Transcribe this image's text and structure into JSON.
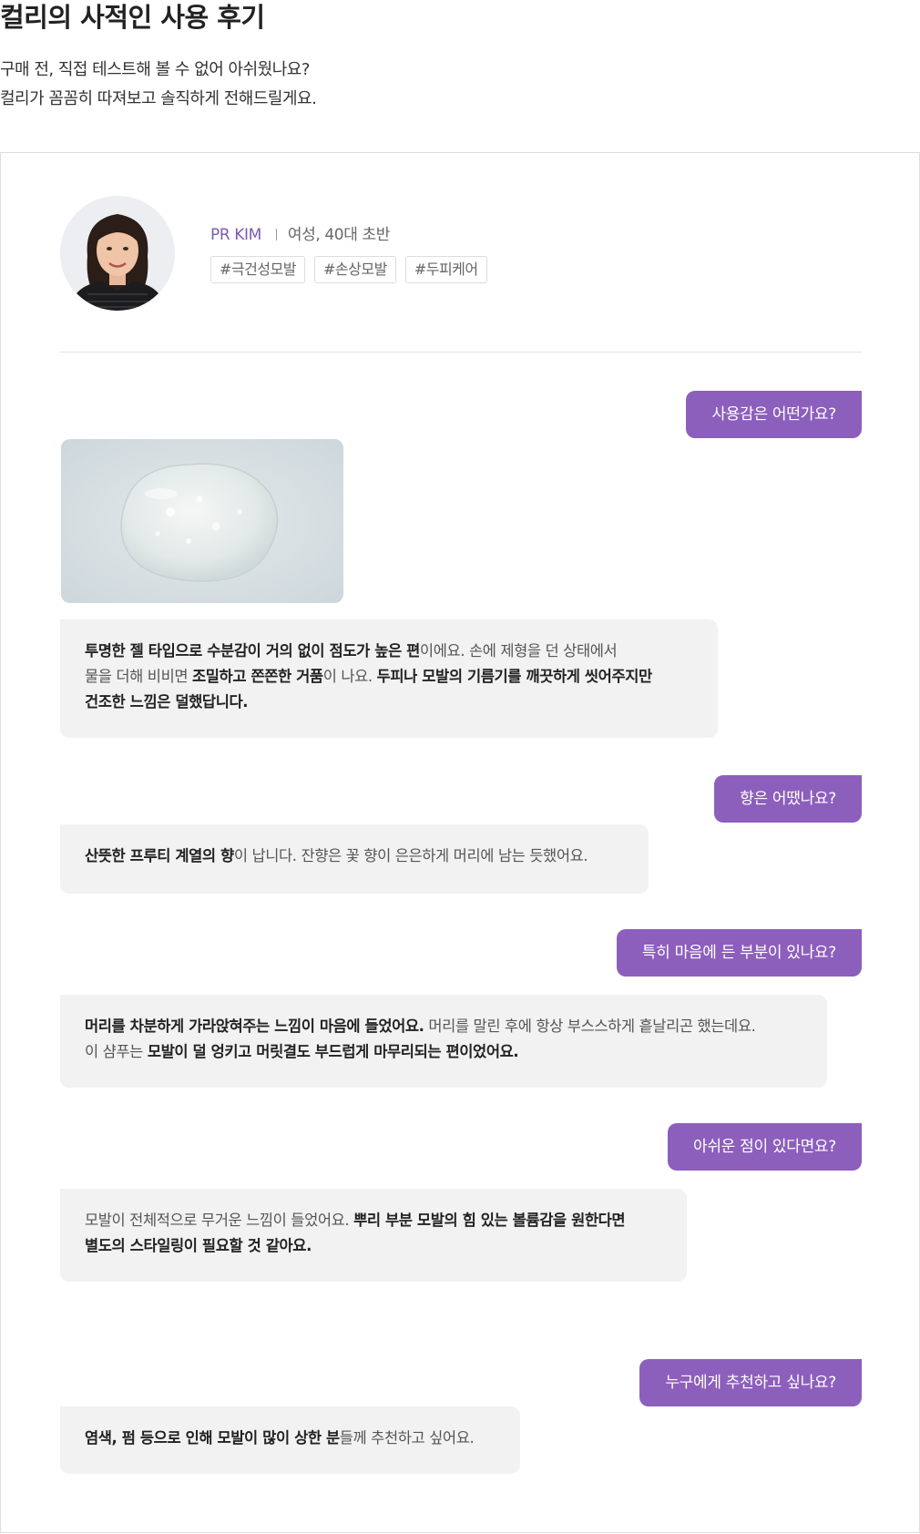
{
  "header": {
    "title": "컬리의 사적인 사용 후기",
    "subtitle_lines": [
      "구매 전, 직접 테스트해 볼 수 없어 아쉬웠나요?",
      "컬리가 꼼꼼히 따져보고 솔직하게 전해드릴게요."
    ]
  },
  "reviewer": {
    "name": "PR KIM",
    "info": "여성, 40대 초반",
    "tags": [
      "#극건성모발",
      "#손상모발",
      "#두피케어"
    ]
  },
  "qa": [
    {
      "question": "사용감은 어떤가요?",
      "answer_lines": [
        [
          {
            "t": "투명한 젤 타입으로 수분감이 거의 없이 점도가 높은 편",
            "b": true
          },
          {
            "t": "이에요. 손에 제형을 던 상태에서",
            "b": false
          }
        ],
        [
          {
            "t": "물을 더해 비비면 ",
            "b": false
          },
          {
            "t": "조밀하고 쫀쫀한 거품",
            "b": true
          },
          {
            "t": "이 나요. ",
            "b": false
          },
          {
            "t": "두피나 모발의 기름기를 깨끗하게 씻어주지만",
            "b": true
          }
        ],
        [
          {
            "t": "건조한 느낌은 덜했답니다.",
            "b": true
          }
        ]
      ]
    },
    {
      "question": "향은 어땠나요?",
      "answer_lines": [
        [
          {
            "t": "산뜻한 프루티 계열의 향",
            "b": true
          },
          {
            "t": "이 납니다. 잔향은 꽃 향이 은은하게 머리에 남는 듯했어요.",
            "b": false
          }
        ]
      ]
    },
    {
      "question": "특히 마음에 든 부분이 있나요?",
      "answer_lines": [
        [
          {
            "t": "머리를 차분하게 가라앉혀주는 느낌이 마음에 들었어요.",
            "b": true
          },
          {
            "t": " 머리를 말린 후에 항상 부스스하게 흩날리곤 했는데요.",
            "b": false
          }
        ],
        [
          {
            "t": "이 샴푸는 ",
            "b": false
          },
          {
            "t": "모발이 덜 엉키고 머릿결도 부드럽게 마무리되는 편이었어요.",
            "b": true
          }
        ]
      ]
    },
    {
      "question": "아쉬운 점이 있다면요?",
      "answer_lines": [
        [
          {
            "t": "모발이 전체적으로 무거운 느낌이 들었어요. ",
            "b": false
          },
          {
            "t": "뿌리 부분 모발의 힘 있는 볼륨감을 원한다면",
            "b": true
          }
        ],
        [
          {
            "t": "별도의 스타일링이 필요할 것 같아요.",
            "b": true
          }
        ]
      ]
    },
    {
      "question": "누구에게 추천하고 싶나요?",
      "answer_lines": [
        [
          {
            "t": "염색, 펌 등으로 인해 모발이 많이 상한 분",
            "b": true
          },
          {
            "t": "들께 추천하고 싶어요.",
            "b": false
          }
        ]
      ]
    }
  ],
  "colors": {
    "accent": "#8c5fbc",
    "name_text": "#7c5ab5",
    "answer_bg": "#f2f2f2",
    "border": "#dddddd"
  }
}
